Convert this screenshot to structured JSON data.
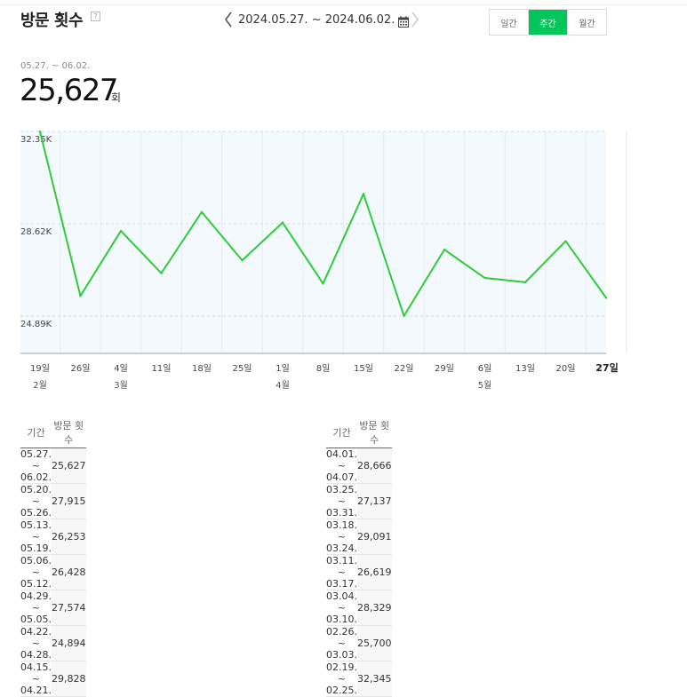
{
  "header": {
    "title": "방문 횟수",
    "help": "?",
    "date_range": "2024.05.27. ~ 2024.06.02.",
    "tabs": [
      "일간",
      "주간",
      "월간"
    ],
    "active_tab": 1
  },
  "summary": {
    "range": "05.27. ~ 06.02.",
    "total": "25,627",
    "unit": "회"
  },
  "colors": {
    "accent": "#03c75a",
    "line": "#2ecc3c",
    "plot_bg": "#f4f9fd"
  },
  "chart_data": {
    "type": "line",
    "x": [
      "2024-02-19",
      "2024-02-26",
      "2024-03-04",
      "2024-03-11",
      "2024-03-18",
      "2024-03-25",
      "2024-04-01",
      "2024-04-08",
      "2024-04-15",
      "2024-04-22",
      "2024-04-29",
      "2024-05-06",
      "2024-05-13",
      "2024-05-20",
      "2024-05-27"
    ],
    "tick_labels": [
      "19일",
      "26일",
      "4일",
      "11일",
      "18일",
      "25일",
      "1일",
      "8일",
      "15일",
      "22일",
      "29일",
      "6일",
      "13일",
      "20일",
      "27일"
    ],
    "month_labels": [
      {
        "index": 0,
        "label": "2월"
      },
      {
        "index": 2,
        "label": "3월"
      },
      {
        "index": 6,
        "label": "4월"
      },
      {
        "index": 11,
        "label": "5월"
      }
    ],
    "series": [
      {
        "values": [
          32345,
          25700,
          28329,
          26619,
          29091,
          27137,
          28666,
          26200,
          29828,
          24894,
          27574,
          26428,
          26253,
          27915,
          25627
        ]
      }
    ],
    "y_ticks": [
      24890,
      28620,
      32350
    ],
    "y_tick_labels": [
      "24.89K",
      "28.62K",
      "32.35K"
    ],
    "ylim": [
      23380,
      32350
    ],
    "grid": true,
    "highlight_index": 14
  },
  "table": {
    "headers": [
      "기간",
      "방문 횟수"
    ],
    "left": [
      [
        "05.27. ~ 06.02.",
        "25,627"
      ],
      [
        "05.20. ~ 05.26.",
        "27,915"
      ],
      [
        "05.13. ~ 05.19.",
        "26,253"
      ],
      [
        "05.06. ~ 05.12.",
        "26,428"
      ],
      [
        "04.29. ~ 05.05.",
        "27,574"
      ],
      [
        "04.22. ~ 04.28.",
        "24,894"
      ],
      [
        "04.15. ~ 04.21.",
        "29,828"
      ]
    ],
    "right": [
      [
        "04.01. ~ 04.07.",
        "28,666"
      ],
      [
        "03.25. ~ 03.31.",
        "27,137"
      ],
      [
        "03.18. ~ 03.24.",
        "29,091"
      ],
      [
        "03.11. ~ 03.17.",
        "26,619"
      ],
      [
        "03.04. ~ 03.10.",
        "28,329"
      ],
      [
        "02.26. ~ 03.03.",
        "25,700"
      ],
      [
        "02.19. ~ 02.25.",
        "32,345"
      ]
    ]
  }
}
